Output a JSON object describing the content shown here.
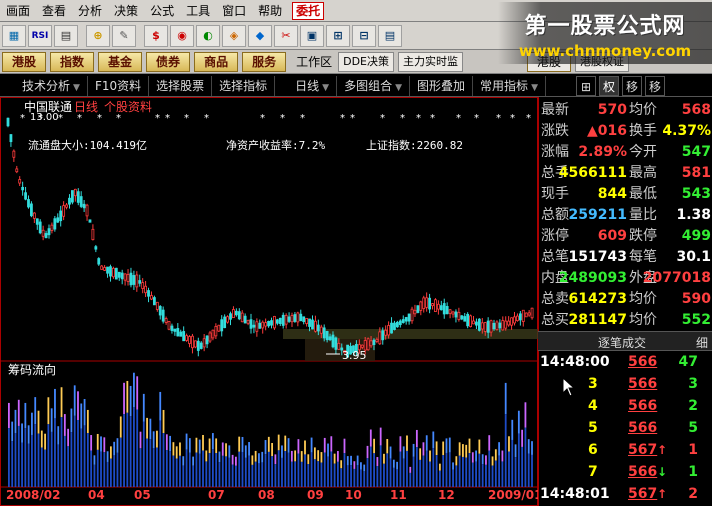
{
  "menu": [
    "画面",
    "查看",
    "分析",
    "决策",
    "公式",
    "工具",
    "窗口",
    "帮助",
    "委托"
  ],
  "toolbar": [
    "▦",
    "RSI",
    "▤",
    "⊕",
    "✎",
    "$",
    "◉",
    "◐",
    "◈",
    "◆",
    "✂",
    "▣",
    "⊞",
    "⊟",
    "▤"
  ],
  "banner": {
    "title": "第一股票公式网",
    "url": "www.chnmoney.com"
  },
  "nav": {
    "buttons": [
      "港股",
      "指数",
      "基金",
      "债券",
      "商品",
      "服务"
    ],
    "workarea": "工作区",
    "right_buttons": [
      "DDE决策",
      "主力实时监",
      "港股",
      "港股权证"
    ]
  },
  "tabs": [
    "技术分析",
    "F10资料",
    "选择股票",
    "选择指标",
    "日线",
    "多图组合",
    "图形叠加",
    "常用指标"
  ],
  "tab_ctrls": [
    "⊞",
    "权",
    "移",
    "移"
  ],
  "stock": {
    "name": "中国联通",
    "period": "日线",
    "info": "个股资料"
  },
  "top_price_label": "13.00",
  "info_line": {
    "float_cap": "流通盘大小:104.419亿",
    "roe": "净资产收益率:7.2%",
    "index": "上证指数:2260.82"
  },
  "low_label": "3.95",
  "indicator_title": "筹码流向",
  "x_axis": [
    "2008/02",
    "04",
    "05",
    "",
    "07",
    "",
    "08",
    "09",
    "10",
    "11",
    "12",
    "2009/01"
  ],
  "quote": [
    {
      "l1": "最新",
      "v1": "570",
      "c1": "red",
      "l2": "均价",
      "v2": "568",
      "c2": "red"
    },
    {
      "l1": "涨跌",
      "v1": "▲016",
      "c1": "red",
      "l2": "换手",
      "v2": "4.37%",
      "c2": "yellow"
    },
    {
      "l1": "涨幅",
      "v1": "2.89%",
      "c1": "red",
      "l2": "今开",
      "v2": "547",
      "c2": "green"
    },
    {
      "l1": "总手",
      "v1": "4566111",
      "c1": "yellow",
      "l2": "最高",
      "v2": "581",
      "c2": "red"
    },
    {
      "l1": "现手",
      "v1": "844",
      "c1": "yellow",
      "l2": "最低",
      "v2": "543",
      "c2": "green"
    },
    {
      "l1": "总额",
      "v1": "259211",
      "c1": "blue",
      "l2": "量比",
      "v2": "1.38",
      "c2": "white"
    },
    {
      "l1": "涨停",
      "v1": "609",
      "c1": "red",
      "l2": "跌停",
      "v2": "499",
      "c2": "green"
    },
    {
      "l1": "总笔",
      "v1": "151743",
      "c1": "white",
      "l2": "每笔",
      "v2": "30.1",
      "c2": "white"
    },
    {
      "l1": "内盘",
      "v1": "2489093",
      "c1": "green",
      "l2": "外盘",
      "v2": "2077018",
      "c2": "red"
    },
    {
      "l1": "总卖",
      "v1": "614273",
      "c1": "yellow",
      "l2": "均价",
      "v2": "590",
      "c2": "red"
    },
    {
      "l1": "总买",
      "v1": "281147",
      "c1": "yellow",
      "l2": "均价",
      "v2": "552",
      "c2": "green"
    }
  ],
  "trades_header": {
    "title": "逐笔成交",
    "detail": "细"
  },
  "trades": [
    {
      "t": "14:48:00",
      "p": "566",
      "a": "",
      "v": "47",
      "c": "green"
    },
    {
      "t": "3",
      "p": "566",
      "a": "",
      "v": "3",
      "c": "green"
    },
    {
      "t": "4",
      "p": "566",
      "a": "",
      "v": "2",
      "c": "green"
    },
    {
      "t": "5",
      "p": "566",
      "a": "",
      "v": "5",
      "c": "green"
    },
    {
      "t": "6",
      "p": "567",
      "a": "↑",
      "v": "1",
      "c": "red"
    },
    {
      "t": "7",
      "p": "566",
      "a": "↓",
      "v": "1",
      "c": "green"
    },
    {
      "t": "14:48:01",
      "p": "567",
      "a": "↑",
      "v": "2",
      "c": "red"
    }
  ]
}
